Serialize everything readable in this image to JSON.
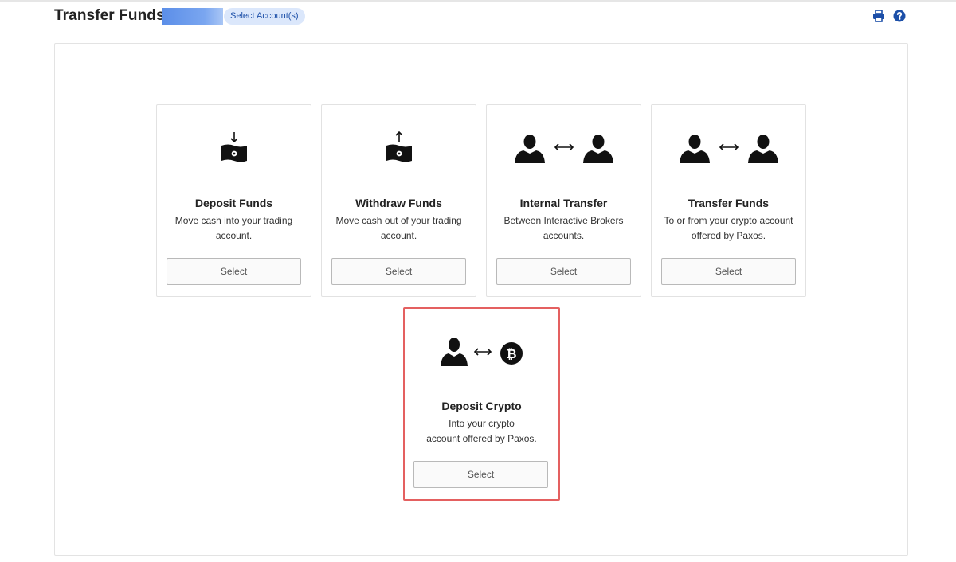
{
  "header": {
    "title": "Transfer Funds",
    "select_accounts_label": "Select Account(s)"
  },
  "cards": [
    {
      "title": "Deposit Funds",
      "line1": "Move cash into your trading",
      "line2": "account.",
      "button": "Select",
      "icon": "cash-deposit-icon"
    },
    {
      "title": "Withdraw Funds",
      "line1": "Move cash out of your trading",
      "line2": "account.",
      "button": "Select",
      "icon": "cash-withdraw-icon"
    },
    {
      "title": "Internal Transfer",
      "line1": "Between Interactive Brokers",
      "line2": "accounts.",
      "button": "Select",
      "icon": "user-transfer-icon"
    },
    {
      "title": "Transfer Funds",
      "line1": "To or from your crypto account",
      "line2": "offered by Paxos.",
      "button": "Select",
      "icon": "user-transfer-icon"
    },
    {
      "title": "Deposit Crypto",
      "line1": "Into your crypto",
      "line2": "account offered by Paxos.",
      "button": "Select",
      "icon": "user-bitcoin-icon"
    }
  ],
  "colors": {
    "accent": "#1c4fa8",
    "highlight_border": "#e46060"
  }
}
